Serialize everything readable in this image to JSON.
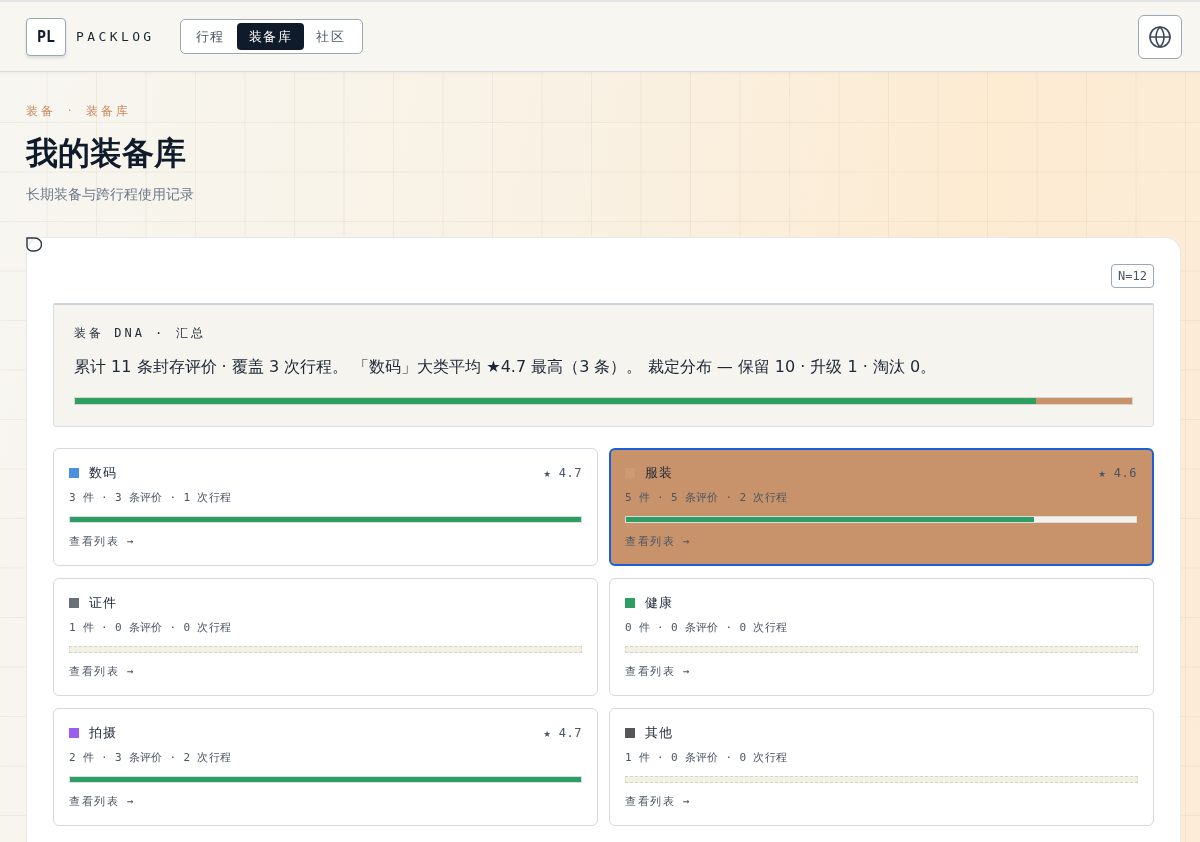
{
  "brand": {
    "mark": "PL",
    "name": "PACKLOG"
  },
  "nav_tabs": [
    {
      "label": "行程",
      "selected": false
    },
    {
      "label": "装备库",
      "selected": true
    },
    {
      "label": "社区",
      "selected": false
    }
  ],
  "breadcrumb": "装备 · 装备库",
  "title": "我的装备库",
  "subtitle": "长期装备与跨行程使用记录",
  "count_badge": "N=12",
  "summary": {
    "label": "装备 DNA · 汇总",
    "text": "累计 11 条封存评价 · 覆盖 3 次行程。 「数码」大类平均 ★4.7 最高（3 条）。 裁定分布 — 保留 10 · 升级 1 · 淘汰 0。",
    "verdict_bar": [
      {
        "level": 0.909,
        "color": "#2e9e62"
      },
      {
        "level": 0.091,
        "color": "#c8916a"
      }
    ]
  },
  "categories": [
    {
      "name": "数码",
      "color": "#4a8fe0",
      "rating": "★ 4.7",
      "stats": "3 件 · 3 条评价 · 1 次行程",
      "empty": false,
      "level": 1,
      "link": "查看列表 →",
      "selected": false
    },
    {
      "name": "服装",
      "color": "#cc9a74",
      "rating": "★ 4.6",
      "stats": "5 件 · 5 条评价 · 2 次行程",
      "empty": false,
      "level": 0.8,
      "link": "查看列表 →",
      "selected": true
    },
    {
      "name": "证件",
      "color": "#6b6f78",
      "stats": "1 件 · 0 条评价 · 0 次行程",
      "empty": true,
      "link": "查看列表 →",
      "selected": false
    },
    {
      "name": "健康",
      "color": "#2e9e62",
      "stats": "0 件 · 0 条评价 · 0 次行程",
      "empty": true,
      "link": "查看列表 →",
      "selected": false
    },
    {
      "name": "拍摄",
      "color": "#9b5cf0",
      "rating": "★ 4.7",
      "stats": "2 件 · 3 条评价 · 2 次行程",
      "empty": false,
      "level": 1,
      "link": "查看列表 →",
      "selected": false
    },
    {
      "name": "其他",
      "color": "#55555c",
      "stats": "1 件 · 0 条评价 · 0 次行程",
      "empty": true,
      "link": "查看列表 →",
      "selected": false
    }
  ]
}
